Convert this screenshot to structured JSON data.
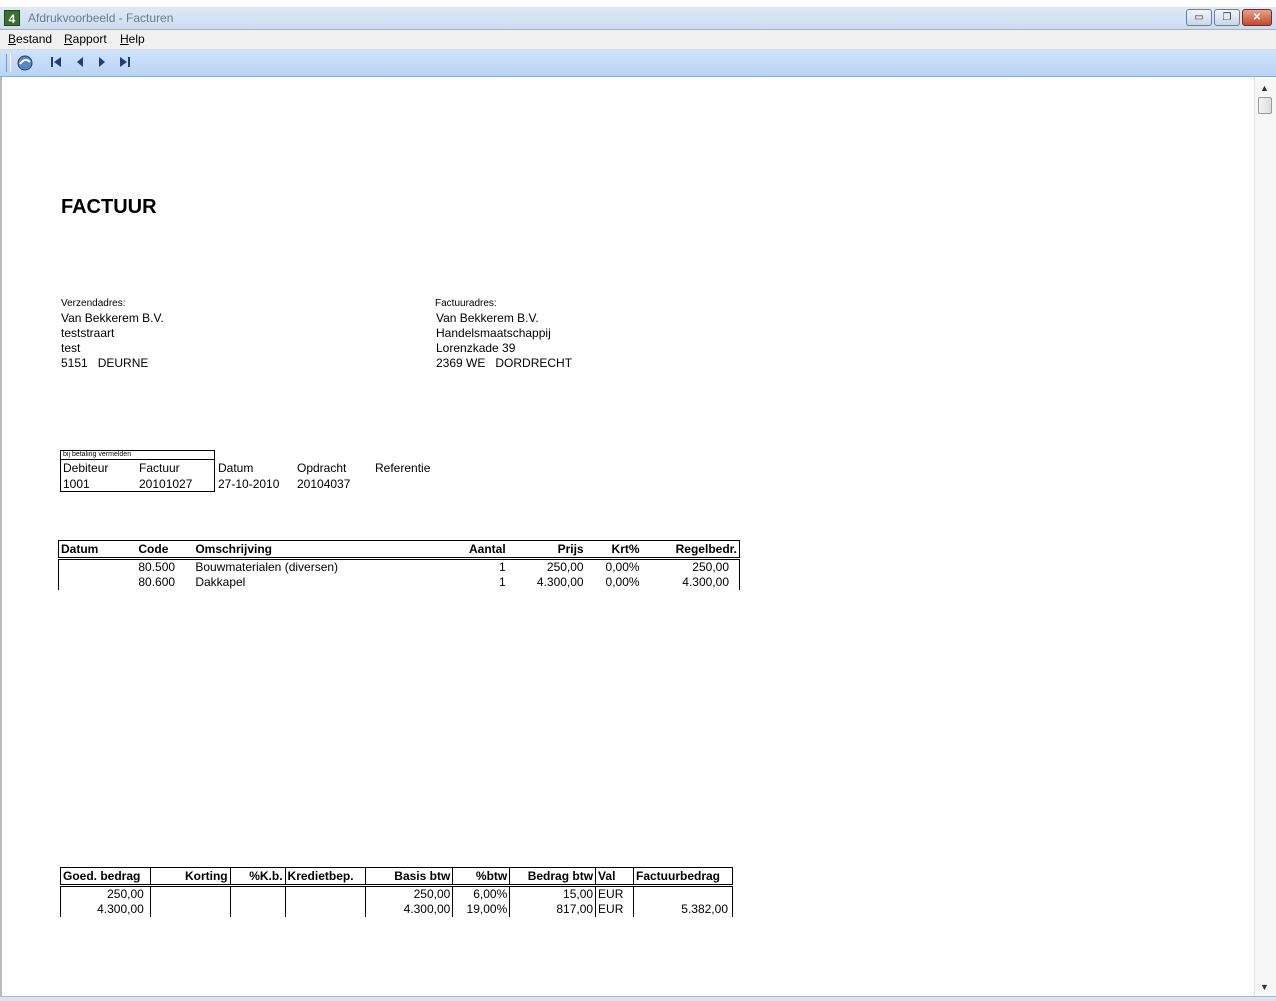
{
  "window": {
    "title": "Afdrukvoorbeeld - Facturen",
    "app_icon_text": "4",
    "buttons": {
      "minimize": "▭",
      "restore": "❐",
      "close": "✕"
    }
  },
  "menu": {
    "bestand_u": "B",
    "bestand_rest": "estand",
    "rapport_u": "R",
    "rapport_rest": "apport",
    "help_u": "H",
    "help_rest": "elp"
  },
  "toolbar": {
    "icons": [
      "export-icon",
      "first-page-icon",
      "previous-page-icon",
      "next-page-icon",
      "last-page-icon"
    ]
  },
  "invoice": {
    "title": "FACTUUR",
    "shipping": {
      "label": "Verzendadres:",
      "line1": "Van Bekkerem B.V.",
      "line2": "teststraart",
      "line3": "test",
      "line4": "5151   DEURNE"
    },
    "billing": {
      "label": "Factuuradres:",
      "line1": "Van Bekkerem B.V.",
      "line2": "Handelsmaatschappij",
      "line3": "Lorenzkade 39",
      "line4": "2369 WE   DORDRECHT"
    },
    "reference": {
      "box_header": "bij betaling vermelden",
      "debiteur_label": "Debiteur",
      "factuur_label": "Factuur",
      "datum_label": "Datum",
      "opdracht_label": "Opdracht",
      "referentie_label": "Referentie",
      "debiteur": "1001",
      "factuur": "20101027",
      "datum": "27-10-2010",
      "opdracht": "20104037",
      "referentie": ""
    },
    "lines": {
      "headers": {
        "datum": "Datum",
        "code": "Code",
        "omschrijving": "Omschrijving",
        "aantal": "Aantal",
        "prijs": "Prijs",
        "krt": "Krt%",
        "regelbedr": "Regelbedr."
      },
      "rows": [
        {
          "datum": "",
          "code": "80.500",
          "omschrijving": "Bouwmaterialen (diversen)",
          "aantal": "1",
          "prijs": "250,00",
          "krt": "0,00%",
          "regelbedr": "250,00"
        },
        {
          "datum": "",
          "code": "80.600",
          "omschrijving": "Dakkapel",
          "aantal": "1",
          "prijs": "4.300,00",
          "krt": "0,00%",
          "regelbedr": "4.300,00"
        }
      ]
    },
    "totals": {
      "headers": {
        "goed": "Goed. bedrag",
        "korting": "Korting",
        "kb": "%K.b.",
        "krediet": "Kredietbep.",
        "basis": "Basis btw",
        "pbtw": "%btw",
        "bedragbtw": "Bedrag btw",
        "val": "Val",
        "factuurbedrag": "Factuurbedrag"
      },
      "rows": [
        {
          "goed": "250,00",
          "korting": "",
          "kb": "",
          "krediet": "",
          "basis": "250,00",
          "pbtw": "6,00%",
          "bedragbtw": "15,00",
          "val": "EUR",
          "factuurbedrag": ""
        },
        {
          "goed": "4.300,00",
          "korting": "",
          "kb": "",
          "krediet": "",
          "basis": "4.300,00",
          "pbtw": "19,00%",
          "bedragbtw": "817,00",
          "val": "EUR",
          "factuurbedrag": "5.382,00"
        }
      ]
    }
  }
}
